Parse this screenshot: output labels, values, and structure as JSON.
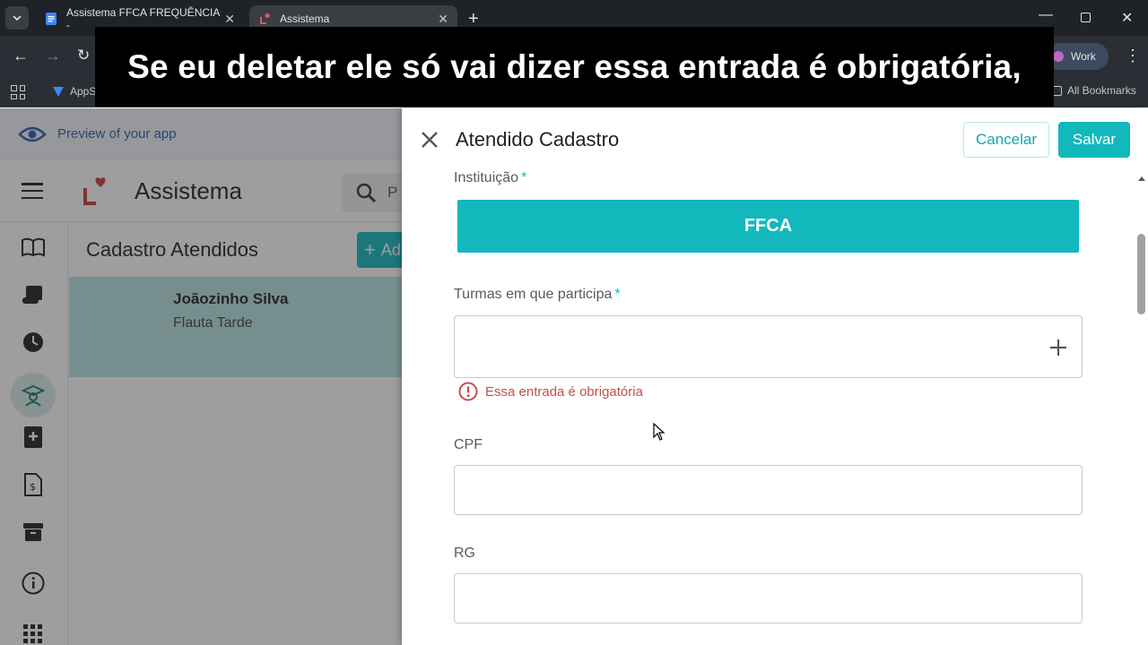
{
  "browser": {
    "tabs": [
      {
        "title": "Assistema FFCA FREQUÊNCIA -"
      },
      {
        "title": "Assistema"
      }
    ],
    "bookmarks": {
      "first": "AppS",
      "all": "All Bookmarks"
    },
    "profile": "Work"
  },
  "caption": {
    "text": "Se eu deletar ele só vai dizer essa entrada é obrigatória,"
  },
  "app": {
    "preview_text": "Preview of your app",
    "title": "Assistema",
    "search_hint": "P",
    "list_title": "Cadastro Atendidos",
    "add_button": "Ad",
    "list_items": [
      {
        "name": "Joãozinho Silva",
        "subtitle": "Flauta Tarde"
      }
    ]
  },
  "panel": {
    "title": "Atendido Cadastro",
    "cancel": "Cancelar",
    "save": "Salvar",
    "instituicao_label": "Instituição",
    "instituicao_value": "FFCA",
    "turmas_label": "Turmas em que participa",
    "turmas_error": "Essa entrada é obrigatória",
    "cpf_label": "CPF",
    "rg_label": "RG",
    "required_mark": "*"
  },
  "colors": {
    "accent": "#13b8bd",
    "error": "#c0504d",
    "chrome": "#1f2328"
  }
}
